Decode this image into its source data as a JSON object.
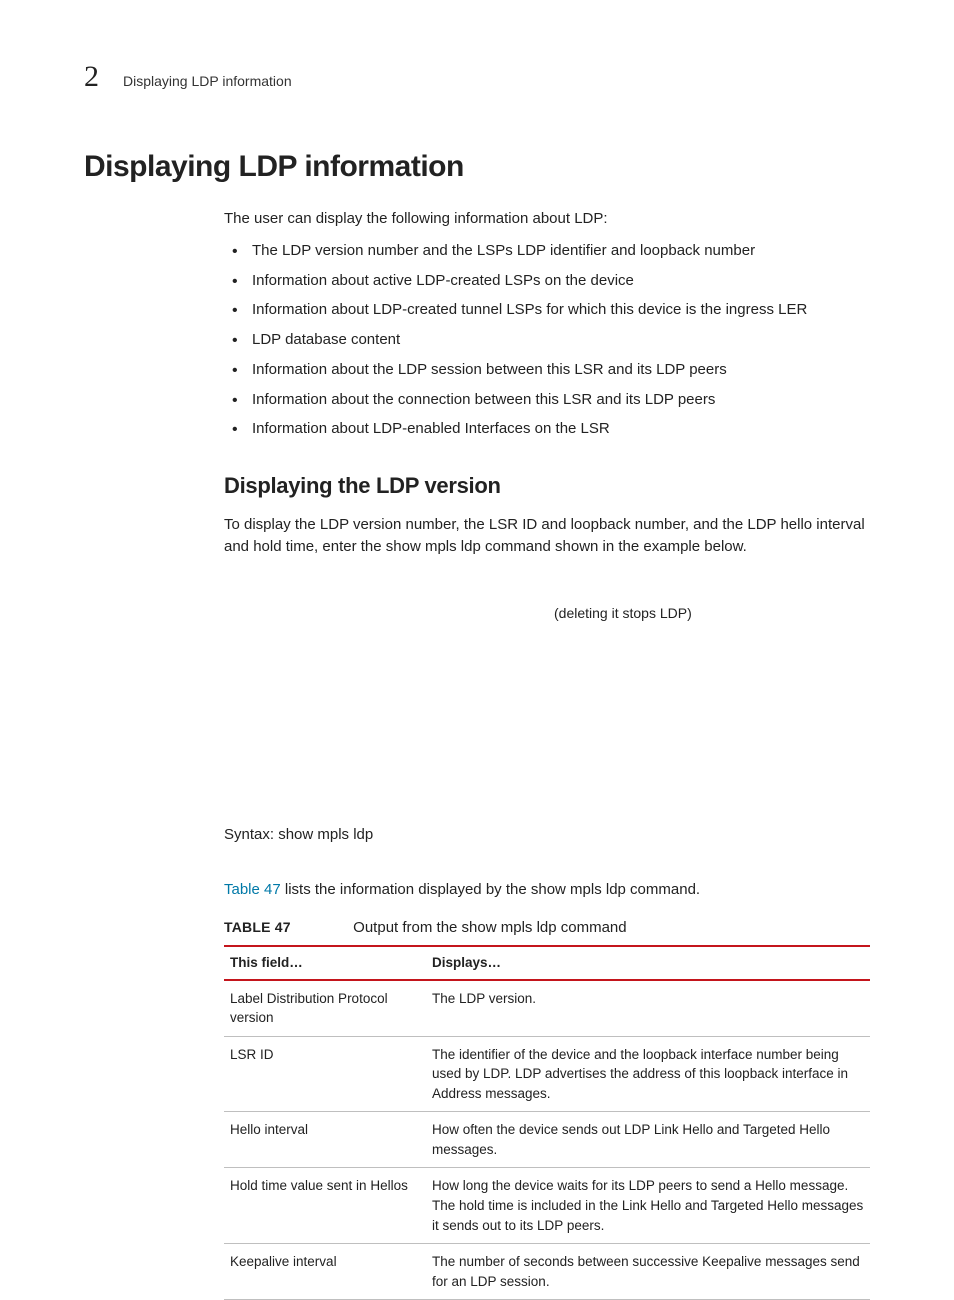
{
  "running_head": {
    "chapter_number": "2",
    "title": "Displaying LDP information"
  },
  "h1": "Displaying LDP information",
  "lead": "The user can display the following information about LDP:",
  "bullets": [
    "The LDP version number and the LSPs LDP identifier and loopback number",
    "Information about active LDP-created LSPs on the device",
    "Information about LDP-created tunnel LSPs for which this device is the ingress LER",
    "LDP database content",
    "Information about the LDP session between this LSR and its LDP peers",
    "Information about the connection between this LSR and its LDP peers",
    "Information about LDP-enabled Interfaces on the LSR"
  ],
  "h2": "Displaying the LDP version",
  "version_para": "To display the LDP version number, the LSR ID and loopback number, and the LDP hello interval and hold time, enter the show mpls ldp command shown in the example below.",
  "aside": "(deleting it stops LDP)",
  "syntax": "Syntax:  show mpls ldp",
  "table_ref": {
    "link": "Table 47",
    "rest": " lists the information displayed by the show mpls ldp command."
  },
  "table": {
    "label": "TABLE 47",
    "title": "Output from the show mpls ldp command",
    "head": {
      "c1": "This field…",
      "c2": "Displays…"
    },
    "rows": [
      {
        "c1": "Label Distribution Protocol version",
        "c2": "The LDP version."
      },
      {
        "c1": "LSR ID",
        "c2": "The identifier of the device and the loopback interface number being used by LDP. LDP advertises the address of this loopback interface in Address messages."
      },
      {
        "c1": "Hello interval",
        "c2": "How often the device sends out LDP Link Hello and Targeted Hello messages."
      },
      {
        "c1": "Hold time value sent in Hellos",
        "c2": "How long the device waits for its LDP peers to send a Hello message. The hold time is included in the Link Hello and Targeted Hello messages it sends out to its LDP peers."
      },
      {
        "c1": "Keepalive interval",
        "c2": "The number of seconds between successive Keepalive messages send for an LDP session."
      }
    ]
  }
}
